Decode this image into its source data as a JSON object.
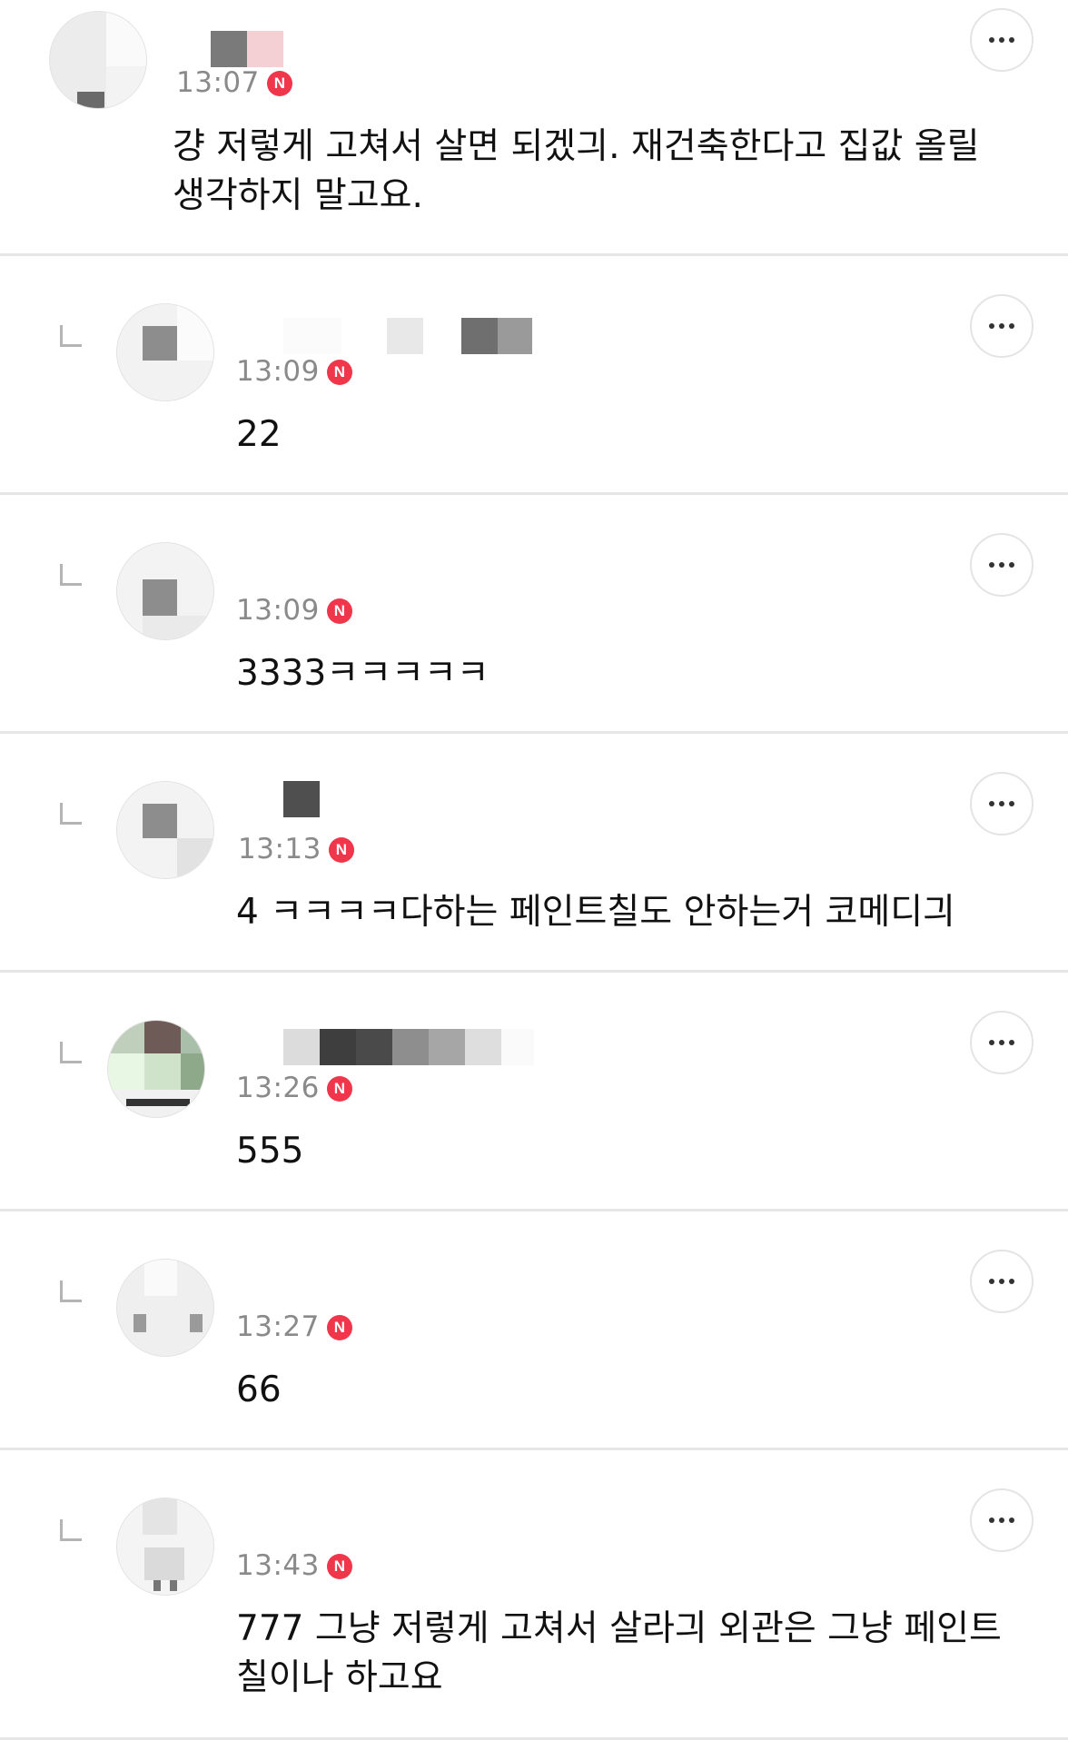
{
  "badge_label": "N",
  "more_icon": "more-horizontal-icon",
  "reply_icon": "reply-arrow-icon",
  "comments": [
    {
      "time": "13:07",
      "text": "걍 저렇게 고쳐서 살면 되겠긔. 재건축한다고 집값 올릴 생각하지 말고요."
    },
    {
      "time": "13:09",
      "text": "22"
    },
    {
      "time": "13:09",
      "text": "3333ㅋㅋㅋㅋㅋ"
    },
    {
      "time": "13:13",
      "text": "4 ㅋㅋㅋㅋ다하는 페인트칠도 안하는거 코메디긔"
    },
    {
      "time": "13:26",
      "text": "555"
    },
    {
      "time": "13:27",
      "text": "66"
    },
    {
      "time": "13:43",
      "text": "777 그냥 저렇게 고쳐서 살라긔 외관은 그냥 페인트 칠이나 하고요"
    }
  ]
}
